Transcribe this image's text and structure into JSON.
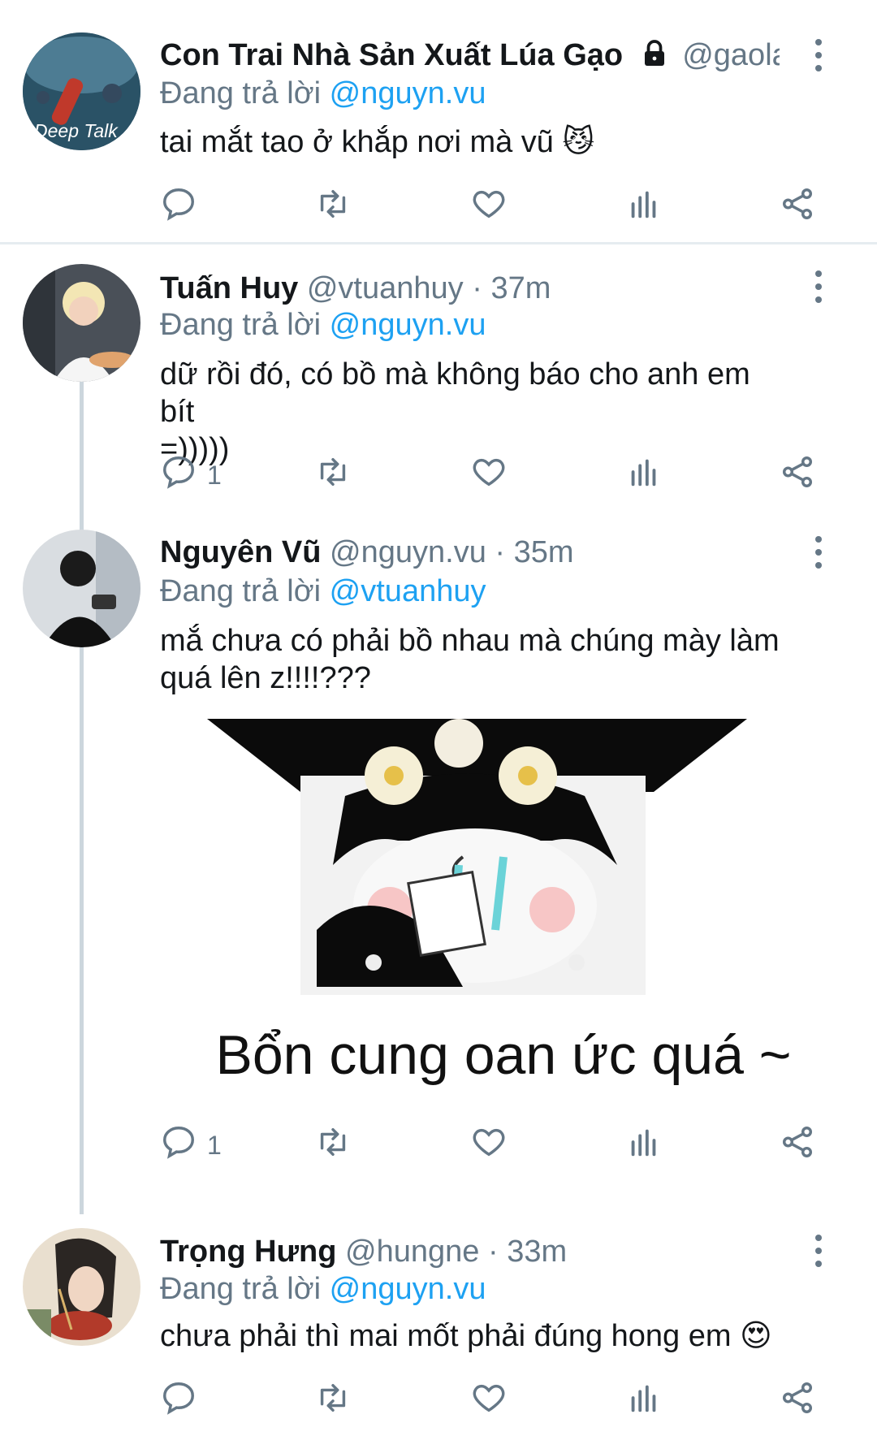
{
  "replying_prefix": "Đang trả lời",
  "tweets": [
    {
      "avatar_label": "Deep Talk",
      "name": "Con Trai Nhà Sản Xuất Lúa Gạo",
      "handle": "@gaola...",
      "time": "",
      "reply_to": "@nguyn.vu",
      "text": "tai mắt tao ở khắp nơi mà vũ 😼",
      "reply_count": ""
    },
    {
      "name": "Tuấn Huy",
      "handle": "@vtuanhuy",
      "time": "· 37m",
      "reply_to": "@nguyn.vu",
      "text_line1": "dữ rồi đó, có bồ mà không báo cho anh em bít",
      "text_line2": "=)))))",
      "reply_count": "1"
    },
    {
      "name": "Nguyên Vũ",
      "handle": "@nguyn.vu",
      "time": "· 35m",
      "reply_to": "@vtuanhuy",
      "text_line1": "mắ chưa có phải bồ nhau mà chúng mày làm",
      "text_line2": "quá lên z!!!!???",
      "media_caption": "Bổn cung oan ức quá ~",
      "reply_count": "1"
    },
    {
      "name": "Trọng Hưng",
      "handle": "@hungne",
      "time": "· 33m",
      "reply_to": "@nguyn.vu",
      "text": "chưa phải thì mai mốt phải đúng hong em 😍",
      "reply_count": ""
    }
  ],
  "icons": [
    "reply-icon",
    "retweet-icon",
    "like-icon",
    "analytics-icon",
    "share-icon",
    "more-icon",
    "lock-icon"
  ],
  "colors": {
    "link": "#1da1f2",
    "muted": "#657786",
    "divider": "#e6ecf0",
    "text": "#14171a"
  }
}
